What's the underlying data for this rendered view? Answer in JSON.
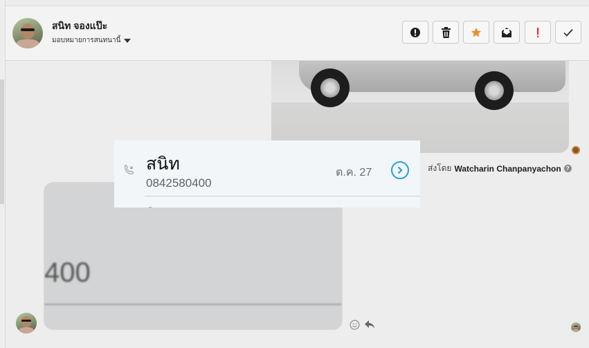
{
  "header": {
    "contact_name": "สนิท จองแป๊ะ",
    "assign_label": "มอบหมายการสนทนานี้"
  },
  "actions": [
    {
      "name": "alert-button",
      "icon": "alert-circle-icon"
    },
    {
      "name": "delete-button",
      "icon": "trash-icon"
    },
    {
      "name": "star-button",
      "icon": "star-icon"
    },
    {
      "name": "mark-unread-button",
      "icon": "envelope-icon"
    },
    {
      "name": "spam-button",
      "icon": "exclamation-icon"
    },
    {
      "name": "done-button",
      "icon": "check-icon"
    }
  ],
  "message": {
    "sent_by_prefix": "ส่งโดย",
    "sent_by_name": "Watcharin Chanpanyachon"
  },
  "call_popup": {
    "name": "สนิท",
    "number": "0842580400",
    "date": "ต.ค. 27",
    "next_initial": "ร"
  },
  "blurred_image": {
    "text": "400"
  },
  "colors": {
    "star": "#e8912d",
    "alert_red": "#d93025",
    "link_blue": "#2a9fd8"
  }
}
